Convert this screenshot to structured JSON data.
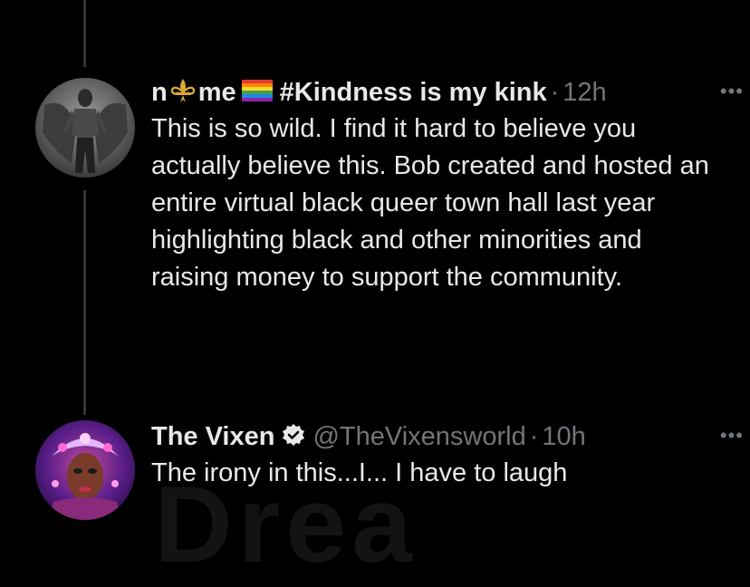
{
  "tweets": [
    {
      "display_name_prefix": "n",
      "display_name_mid": "me",
      "display_name_suffix": "#Kindness is my kink",
      "icon_1": "fleur-de-lis-icon",
      "icon_2": "rainbow-flag-icon",
      "time": "12h",
      "more": "•••",
      "body": "This is so wild. I find it hard to believe you actually believe this. Bob created and hosted an entire virtual black queer town hall last year highlighting black and other minorities and raising money to support the community."
    },
    {
      "display_name": "The Vixen",
      "verified_icon": "verified-badge-icon",
      "handle": "@TheVixensworld",
      "time": "10h",
      "more": "•••",
      "body": "The irony in this...I... I have to laugh"
    }
  ],
  "colors": {
    "background": "#000000",
    "text": "#e7e9ea",
    "muted": "#71767b",
    "thread_line": "#333639"
  }
}
